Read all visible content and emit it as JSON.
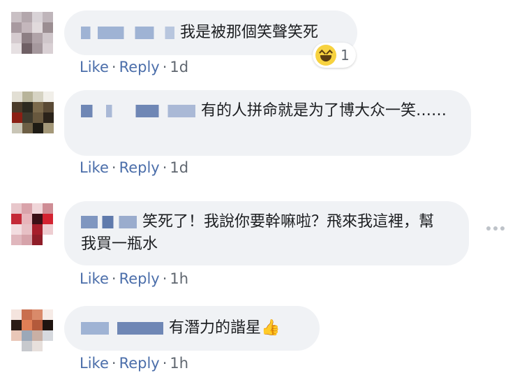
{
  "comments": [
    {
      "text": "我是被那個笑聲笑死",
      "like": "Like",
      "reply": "Reply",
      "time": "1d",
      "reaction_count": "1",
      "reaction_icon": "laugh-reaction-icon"
    },
    {
      "text": "有的人拼命就是为了博大众一笑……",
      "like": "Like",
      "reply": "Reply",
      "time": "1d"
    },
    {
      "text": "笑死了！我說你要幹嘛啦？飛來我這裡，幫我買一瓶水",
      "like": "Like",
      "reply": "Reply",
      "time": "1h"
    },
    {
      "text": "有潛力的諧星",
      "like": "Like",
      "reply": "Reply",
      "time": "1h",
      "trailing_icon": "thumbs-up-icon"
    }
  ],
  "colors": {
    "link": "#4b6eaa",
    "bubble": "#f0f2f5",
    "text": "#1c1e21",
    "meta": "#606770"
  },
  "separator": "·"
}
